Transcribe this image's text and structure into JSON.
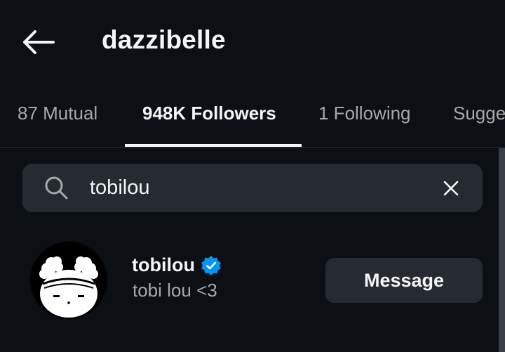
{
  "header": {
    "title": "dazzibelle",
    "back_icon": "arrow-left-icon"
  },
  "tabs": [
    {
      "label": "87 Mutual",
      "active": false
    },
    {
      "label": "948K Followers",
      "active": true
    },
    {
      "label": "1 Following",
      "active": false
    },
    {
      "label": "Suggested",
      "active": false
    }
  ],
  "search": {
    "value": "tobilou",
    "search_icon": "search-icon",
    "clear_icon": "close-icon"
  },
  "results": [
    {
      "username": "tobilou",
      "verified": true,
      "full_name": "tobi lou <3",
      "action_label": "Message",
      "avatar_icon": "cartoon-avatar"
    }
  ],
  "colors": {
    "background": "#0c0f14",
    "surface": "#262a31",
    "text_primary": "#f5f5f5",
    "text_secondary": "#a8a8a8",
    "verified_blue": "#0095f6"
  }
}
